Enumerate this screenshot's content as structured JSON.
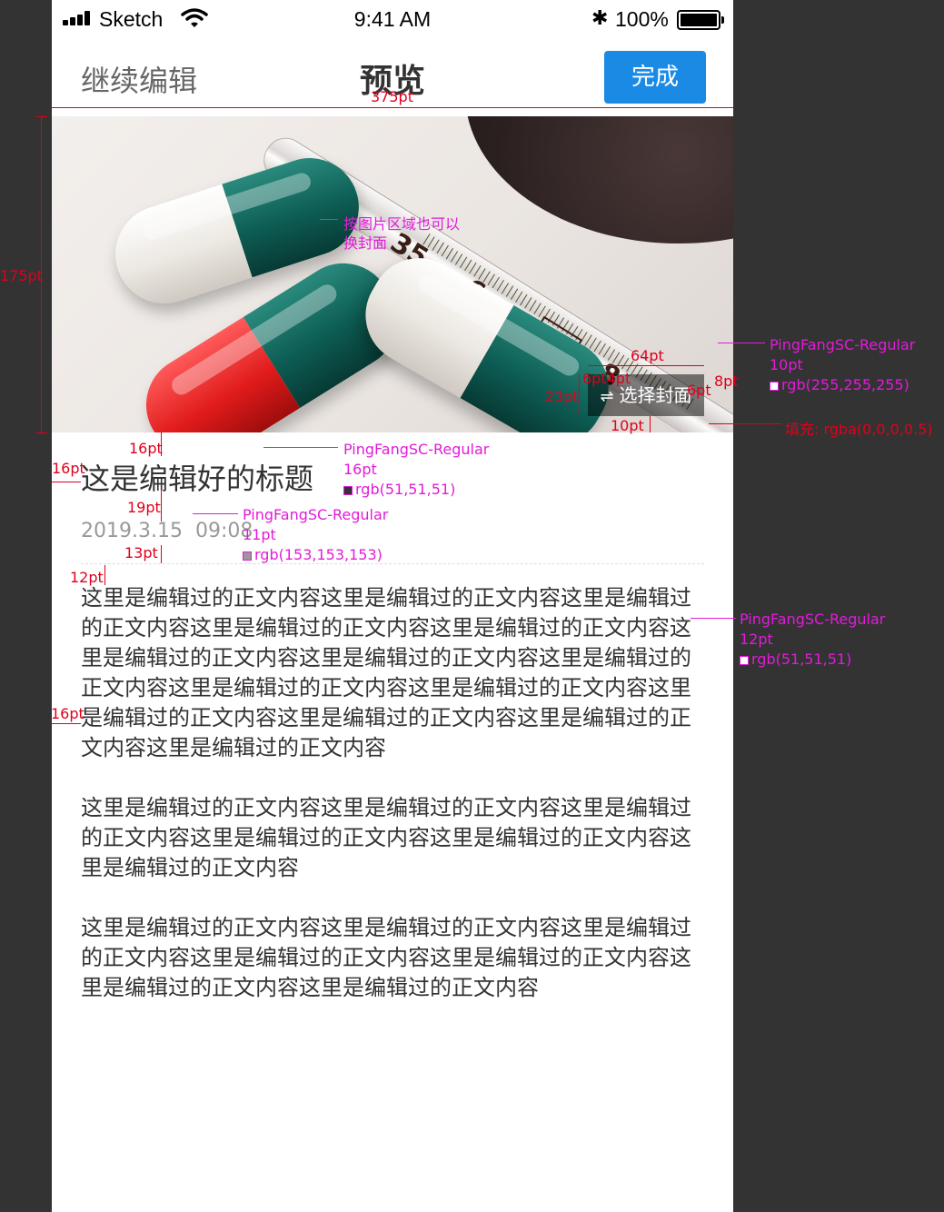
{
  "status_bar": {
    "carrier": "Sketch",
    "time": "9:41 AM",
    "battery": "100%"
  },
  "nav": {
    "back_label": "继续编辑",
    "title": "预览",
    "done_label": "完成"
  },
  "cover": {
    "change_button_label": "选择封面",
    "thermometer_numbers": [
      "35",
      "6",
      "37",
      "8"
    ]
  },
  "article": {
    "title": "这是编辑好的标题",
    "date": "2019.3.15",
    "time": "09:08",
    "paragraphs": [
      "这里是编辑过的正文内容这里是编辑过的正文内容这里是编辑过的正文内容这里是编辑过的正文内容这里是编辑过的正文内容这里是编辑过的正文内容这里是编辑过的正文内容这里是编辑过的正文内容这里是编辑过的正文内容这里是编辑过的正文内容这里是编辑过的正文内容这里是编辑过的正文内容这里是编辑过的正文内容这里是编辑过的正文内容",
      "这里是编辑过的正文内容这里是编辑过的正文内容这里是编辑过的正文内容这里是编辑过的正文内容这里是编辑过的正文内容这里是编辑过的正文内容",
      "这里是编辑过的正文内容这里是编辑过的正文内容这里是编辑过的正文内容这里是编辑过的正文内容这里是编辑过的正文内容这里是编辑过的正文内容这里是编辑过的正文内容"
    ]
  },
  "annotations": {
    "width_375": "375pt",
    "height_175": "175pt",
    "cover_hint": [
      "按图片区域也可以",
      "换封面"
    ],
    "btn_width": "64pt",
    "btn_pad": "6pt4pt",
    "btn_height": "23pt",
    "btn_right": "8pt",
    "btn_gap": "6pt",
    "btn_bottom": "10pt",
    "btn_font": "PingFangSC-Regular",
    "btn_size": "10pt",
    "btn_color": "rgb(255,255,255)",
    "btn_fill": "填充: rgba(0,0,0,0.5)",
    "title_top": "16pt",
    "title_left": "16pt",
    "title_font": "PingFangSC-Regular",
    "title_size": "16pt",
    "title_color": "rgb(51,51,51)",
    "meta_gap": "19pt",
    "meta_font": "PingFangSC-Regular",
    "meta_size": "11pt",
    "meta_color": "rgb(153,153,153)",
    "meta_bottom": "13pt",
    "body_top": "12pt",
    "body_left": "16pt",
    "body_font": "PingFangSC-Regular",
    "body_size": "12pt",
    "body_color": "rgb(51,51,51)"
  },
  "colors": {
    "primary": "#1a8ae5",
    "title_text": "#333333",
    "meta_text": "#999999",
    "annotation_red": "#e0001b",
    "annotation_magenta": "#e21bd9"
  }
}
